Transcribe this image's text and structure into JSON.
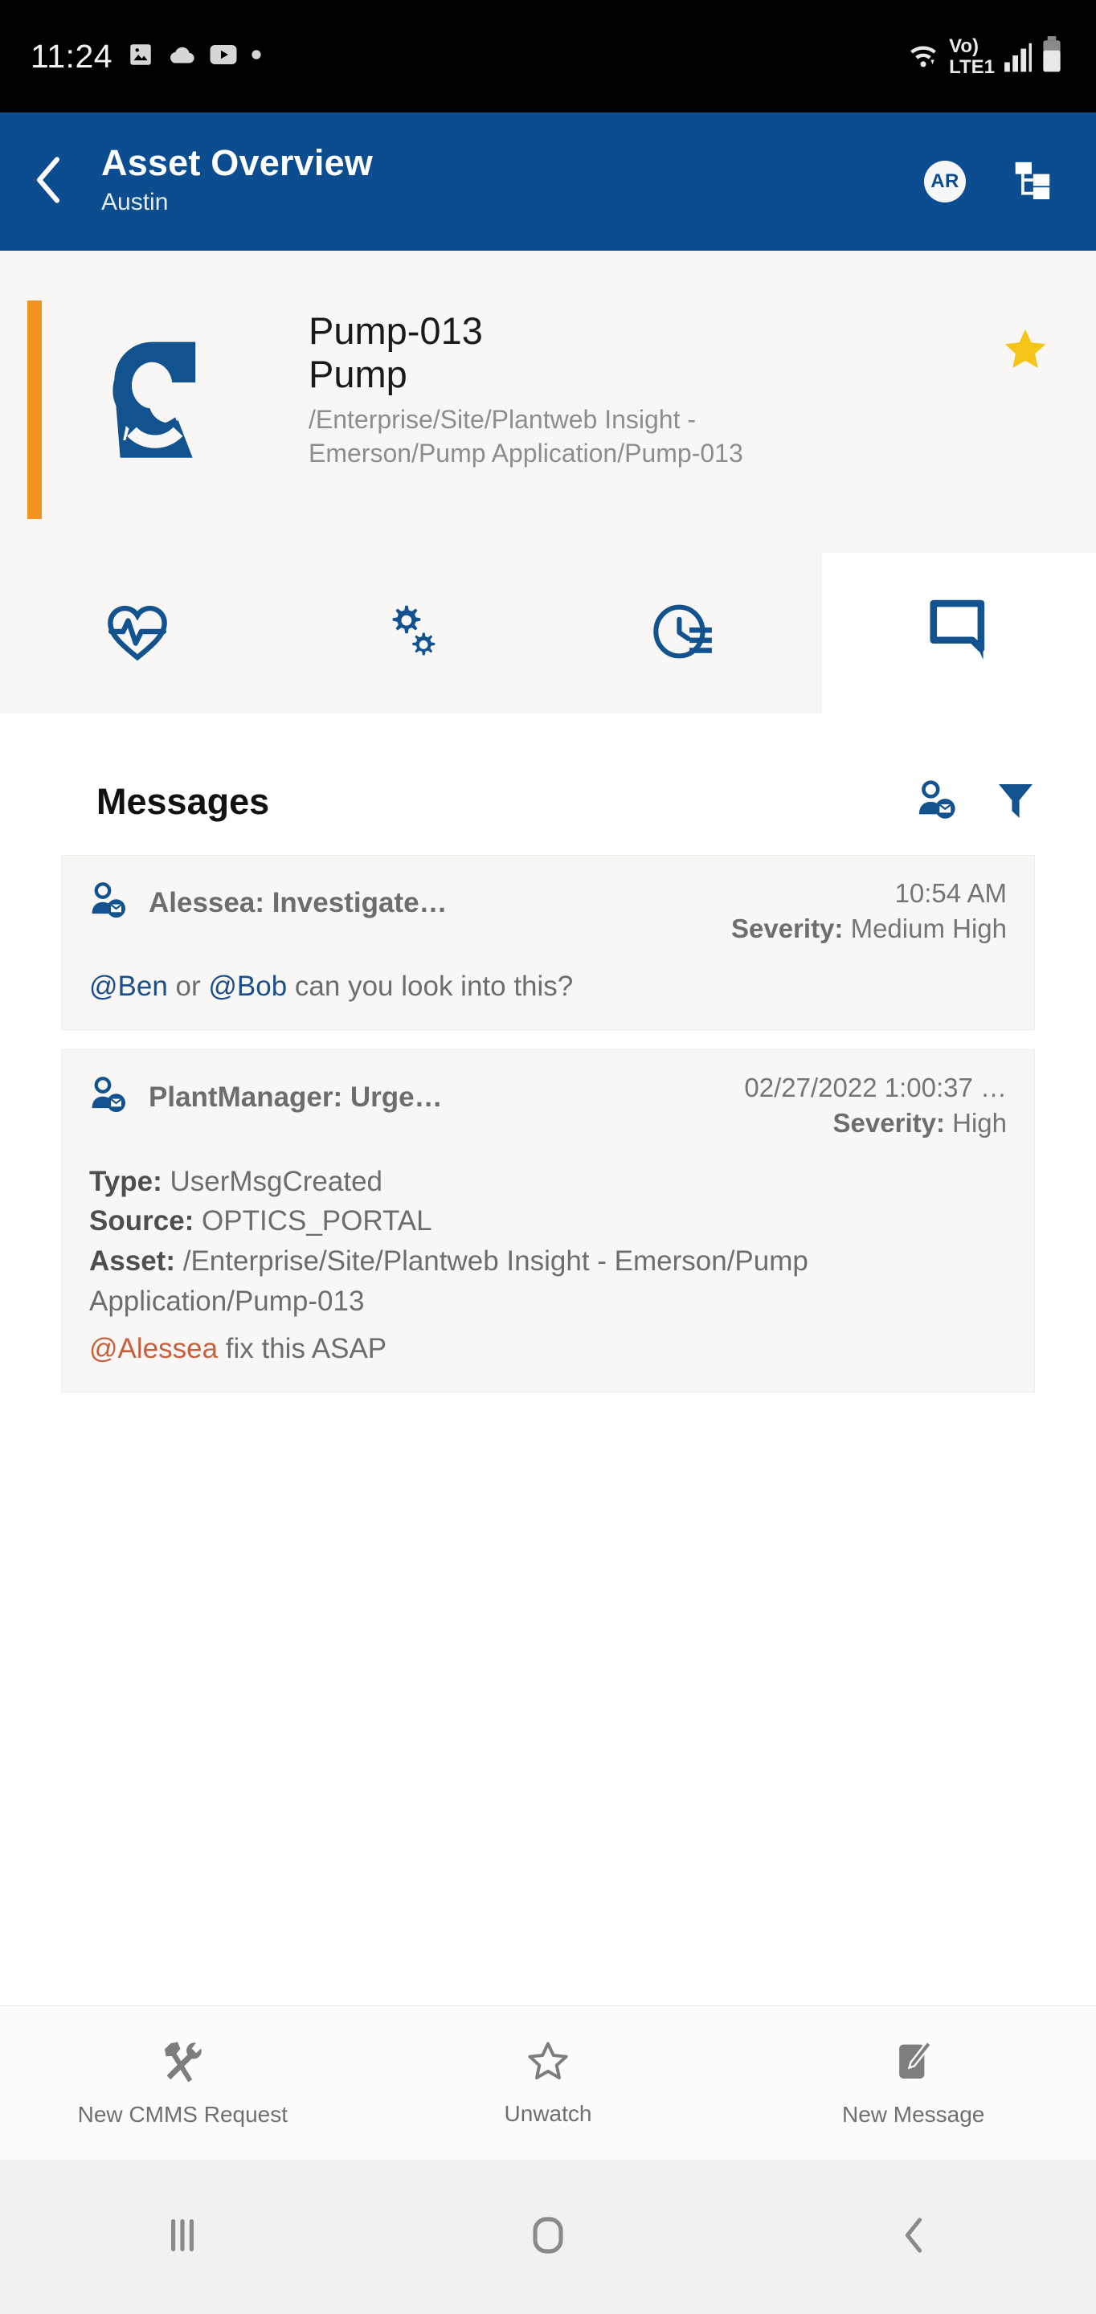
{
  "statusbar": {
    "time": "11:24",
    "left_icons": [
      "image-icon",
      "cloud-icon",
      "youtube-icon",
      "dot-icon"
    ],
    "network_label": "LTE1",
    "volte_label": "Vo)",
    "right_icons": [
      "wifi-icon",
      "volte-icon",
      "signal-bars-icon",
      "battery-icon"
    ]
  },
  "appbar": {
    "back_icon": "chevron-left-icon",
    "title": "Asset Overview",
    "subtitle": "Austin",
    "ar_badge": "AR",
    "hierarchy_icon": "hierarchy-tree-icon",
    "bg_color": "#0b4d8f"
  },
  "asset": {
    "icon": "pump-icon",
    "name": "Pump-013",
    "type": "Pump",
    "path": "/Enterprise/Site/Plantweb Insight - Emerson/Pump Application/Pump-013",
    "favorite_icon": "star-filled-icon",
    "favorite_color": "#f5c518",
    "accent_color": "#f0941f"
  },
  "tabs": [
    {
      "icon": "heart-pulse-icon",
      "name": "health",
      "active": false
    },
    {
      "icon": "gears-icon",
      "name": "settings",
      "active": false
    },
    {
      "icon": "clock-list-icon",
      "name": "history",
      "active": false
    },
    {
      "icon": "message-bubble-icon",
      "name": "messages",
      "active": true
    }
  ],
  "messages_section": {
    "title": "Messages",
    "add_user_message_icon": "user-message-icon",
    "filter_icon": "filter-funnel-icon",
    "items": [
      {
        "icon": "user-message-icon",
        "sender_subject": "Alessea: Investigate…",
        "time": "10:54 AM",
        "severity_label": "Severity:",
        "severity_value": "Medium High",
        "body_parts": [
          {
            "text": "@Ben",
            "style": "mention-blue"
          },
          {
            "text": " or ",
            "style": "plain"
          },
          {
            "text": "@Bob",
            "style": "mention-blue"
          },
          {
            "text": " can you look into this?",
            "style": "plain"
          }
        ]
      },
      {
        "icon": "user-message-icon",
        "sender_subject": "PlantManager: Urge…",
        "time": "02/27/2022 1:00:37 …",
        "severity_label": "Severity:",
        "severity_value": "High",
        "details": [
          {
            "label": "Type:",
            "value": "UserMsgCreated"
          },
          {
            "label": "Source:",
            "value": "OPTICS_PORTAL"
          },
          {
            "label": "Asset:",
            "value": "/Enterprise/Site/Plantweb Insight - Emerson/Pump Application/Pump-013"
          }
        ],
        "body_parts": [
          {
            "text": "@Alessea",
            "style": "mention-orange"
          },
          {
            "text": " fix this ASAP",
            "style": "plain"
          }
        ]
      }
    ]
  },
  "actionbar": [
    {
      "icon": "tools-icon",
      "label": "New CMMS Request"
    },
    {
      "icon": "star-outline-icon",
      "label": "Unwatch"
    },
    {
      "icon": "compose-message-icon",
      "label": "New Message"
    }
  ],
  "navbar": [
    {
      "icon": "recents-icon",
      "name": "recents"
    },
    {
      "icon": "home-icon",
      "name": "home"
    },
    {
      "icon": "back-icon",
      "name": "back"
    }
  ]
}
